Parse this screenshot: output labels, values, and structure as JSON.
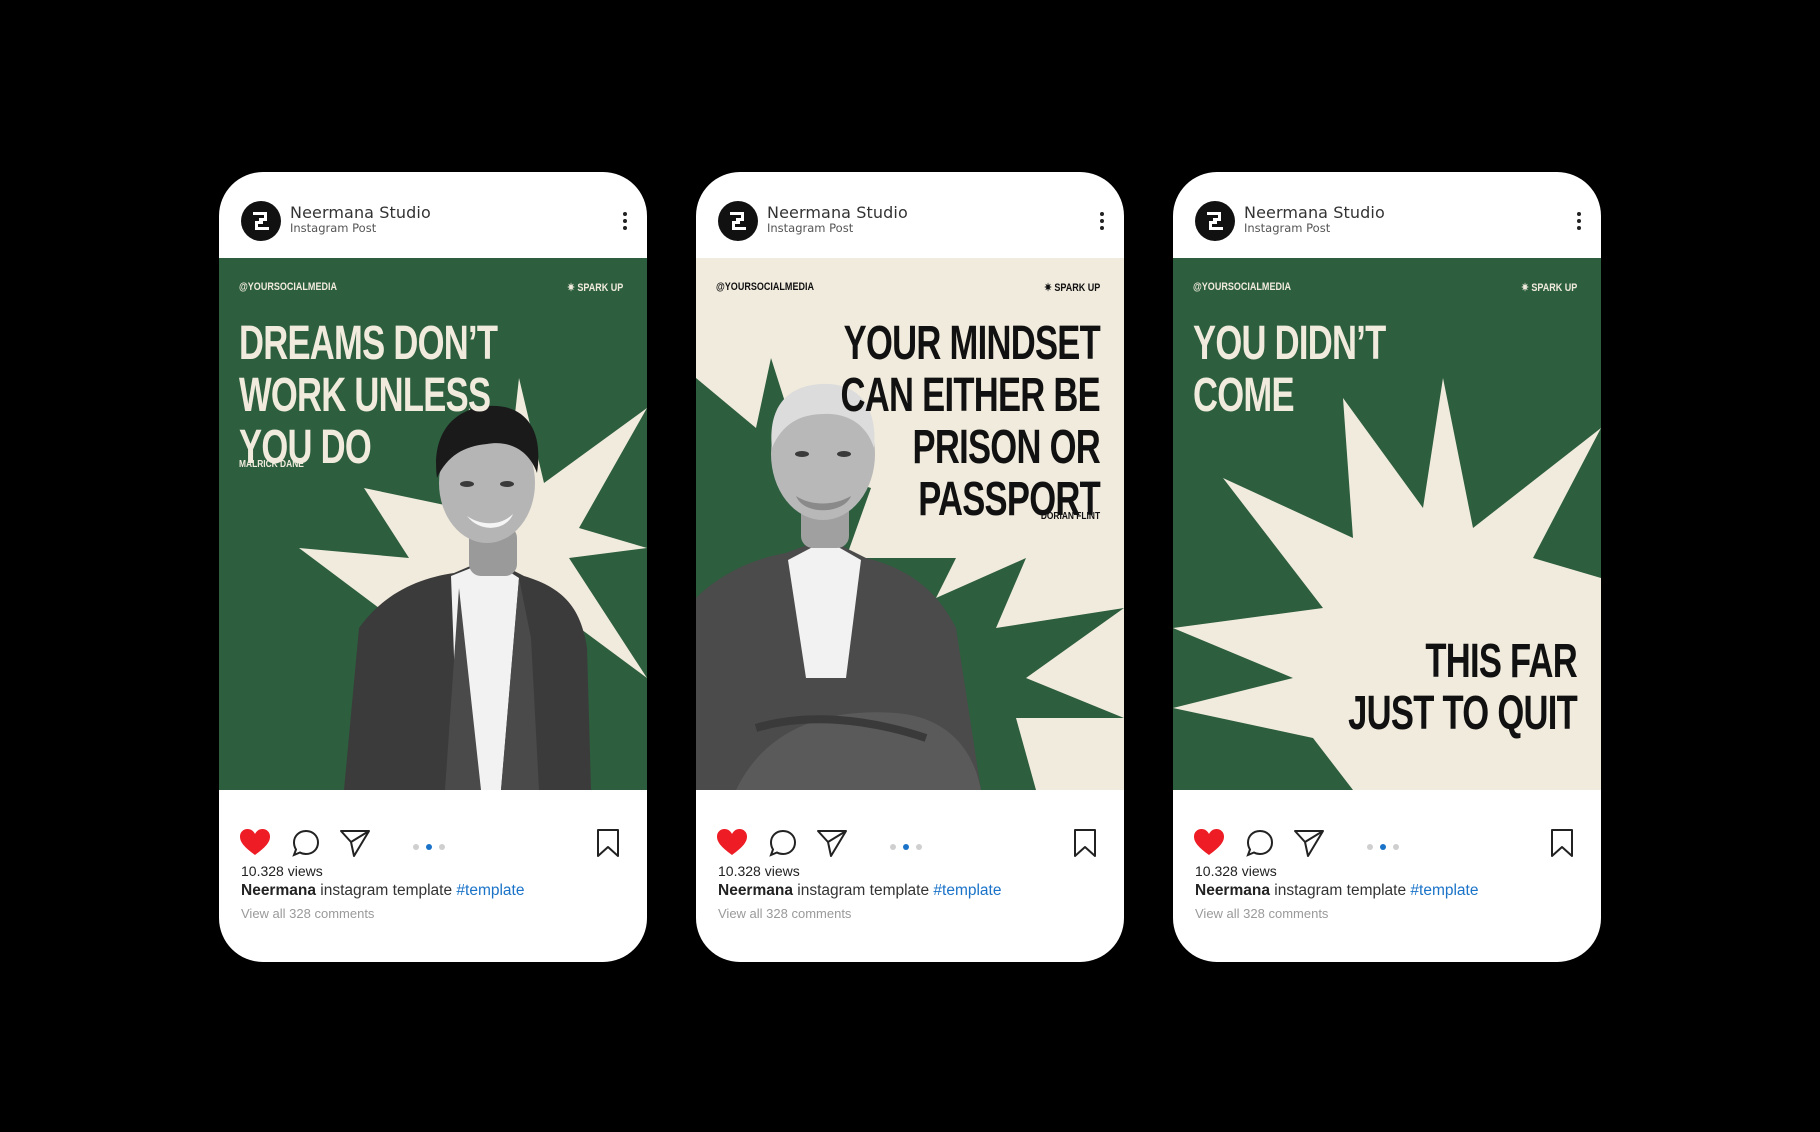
{
  "colors": {
    "background": "#000000",
    "green": "#2d5e3e",
    "cream": "#f1ebdd",
    "heart": "#ee1c24",
    "hashtag": "#1a73c8",
    "active_dot": "#1a73c8"
  },
  "posts": [
    {
      "account_name": "Neermana Studio",
      "account_subtitle": "Instagram Post",
      "handle": "@YOURSOCIALMEDIA",
      "brand": "✷ SPARK UP",
      "headline": "DREAMS DON’T\nWORK UNLESS\nYOU DO",
      "author": "MALRICK DANE",
      "theme": "green",
      "views": "10.328 views",
      "caption_user": "Neermana",
      "caption_text": " instagram template ",
      "caption_tag": "#template",
      "comments": "View all 328 comments",
      "liked": true,
      "active_slide": 2,
      "slides": 3
    },
    {
      "account_name": "Neermana Studio",
      "account_subtitle": "Instagram Post",
      "handle": "@YOURSOCIALMEDIA",
      "brand": "✷ SPARK UP",
      "headline": "YOUR MINDSET\nCAN EITHER BE\nPRISON OR\nPASSPORT",
      "author": "DORIAN FLINT",
      "theme": "cream",
      "views": "10.328 views",
      "caption_user": "Neermana",
      "caption_text": " instagram template ",
      "caption_tag": "#template",
      "comments": "View all 328 comments",
      "liked": true,
      "active_slide": 2,
      "slides": 3
    },
    {
      "account_name": "Neermana Studio",
      "account_subtitle": "Instagram Post",
      "handle": "@YOURSOCIALMEDIA",
      "brand": "✷ SPARK UP",
      "headline": "YOU DIDN’T\nCOME",
      "headline_2": "THIS FAR\nJUST TO QUIT",
      "theme": "green",
      "views": "10.328 views",
      "caption_user": "Neermana",
      "caption_text": " instagram template ",
      "caption_tag": "#template",
      "comments": "View all 328 comments",
      "liked": true,
      "active_slide": 2,
      "slides": 3
    }
  ],
  "icons": {
    "avatar": "studio-logo-icon",
    "more": "more-vertical-icon",
    "like": "heart-icon",
    "comment": "comment-icon",
    "share": "send-icon",
    "save": "bookmark-icon"
  }
}
